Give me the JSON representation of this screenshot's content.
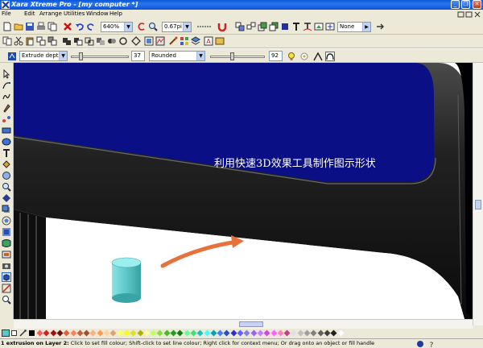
{
  "window": {
    "title": "Xara Xtreme Pro - [my computer *]",
    "minimize": "_",
    "restore": "❐",
    "close": "✕"
  },
  "menu": [
    "File",
    "Edit",
    "Arrange",
    "Utilities",
    "Window",
    "Help"
  ],
  "toolbar": {
    "zoom": "640%",
    "line_width": "0.67pi",
    "none_select": "None"
  },
  "infobar": {
    "extrude_type": "Extrude depth",
    "depth_value": "37",
    "bevel_type": "Rounded",
    "bevel_value": "92"
  },
  "canvas": {
    "annotation": "利用快速3D效果工具制作图示形状"
  },
  "colors": {
    "screen_blue": "#0a0f86",
    "bezel_dark": "#1c1c1c",
    "cylinder": "#5dc7c8",
    "arrow": "#e8703a"
  },
  "palette": [
    "#ff5a5a",
    "#d22222",
    "#a01010",
    "#701010",
    "#e06040",
    "#ff8060",
    "#c86040",
    "#a05030",
    "#ffb080",
    "#ff9850",
    "#ffd0a0",
    "#e0a070",
    "#ffff60",
    "#ffff00",
    "#e0e020",
    "#b0b000",
    "#ffffa0",
    "#c0ff60",
    "#80e040",
    "#40c020",
    "#20a020",
    "#108010",
    "#60ffa0",
    "#40e080",
    "#20c0c0",
    "#40ffff",
    "#00a0c0",
    "#4080ff",
    "#2050d0",
    "#3030c0",
    "#6060ff",
    "#8080e0",
    "#a060ff",
    "#c080ff",
    "#e040e0",
    "#ff60ff",
    "#ff80c0",
    "#c04080",
    "#e0e0e0",
    "#c0c0c0",
    "#a0a0a0",
    "#808080",
    "#606060",
    "#404040",
    "#202020",
    "#ffffff"
  ],
  "status": {
    "prefix": "1 extrusion on Layer 2:",
    "message": " Click to set fill colour; Shift-click to set line colour; Right click for context menu; Or drag onto an object or fill handle"
  }
}
